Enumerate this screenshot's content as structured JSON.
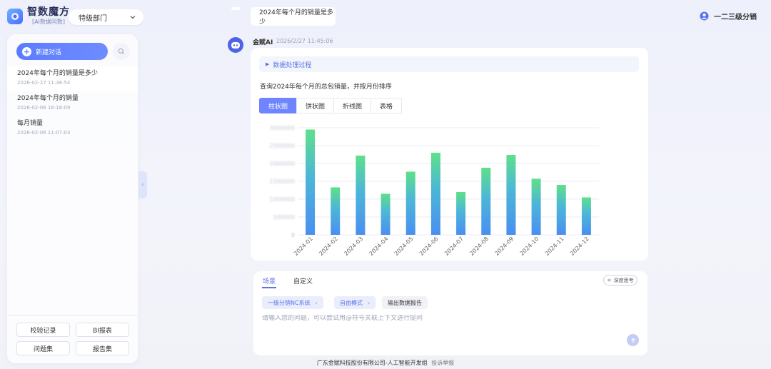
{
  "brand": {
    "name": "智数魔方",
    "subtitle": "[AI数据问数]"
  },
  "department_select": {
    "value": "特级部门"
  },
  "sidebar": {
    "new_chat_label": "新建对话",
    "conversations": [
      {
        "title": "2024年每个月的销量是多少",
        "time": "2026-02-27 11:38:54"
      },
      {
        "title": "2024年每个月的销量",
        "time": "2026-02-06 16:18:09"
      },
      {
        "title": "每月销量",
        "time": "2026-02-06 11:07:03"
      }
    ],
    "buttons": {
      "verify": "校验记录",
      "bi": "BI报表",
      "questions": "问题集",
      "reports": "报告集"
    }
  },
  "header": {
    "user_name": "一二三级分销"
  },
  "chat": {
    "user_message": "2024年每个月的销量是多少",
    "ai_name": "金赋AI",
    "ai_time": "2026/2/27 11:45:06",
    "process_label": "数据处理过程",
    "answer_text": "查询2024年每个月的总包销量，并按月份排序",
    "chart_tabs": [
      "柱状图",
      "饼状图",
      "折线图",
      "表格"
    ],
    "active_tab": 0
  },
  "chart_data": {
    "type": "bar",
    "categories": [
      "2024-01",
      "2024-02",
      "2024-03",
      "2024-04",
      "2024-05",
      "2024-06",
      "2024-07",
      "2024-08",
      "2024-09",
      "2024-10",
      "2024-11",
      "2024-12"
    ],
    "values": [
      2950000,
      1330000,
      2220000,
      1150000,
      1770000,
      2300000,
      1200000,
      1880000,
      2240000,
      1570000,
      1400000,
      1050000
    ],
    "ylim": [
      0,
      3000000
    ],
    "yticks": [
      0,
      500000,
      1000000,
      1500000,
      2000000,
      2500000,
      3000000
    ],
    "ytick_labels_blurred": true,
    "grid": true,
    "colors": {
      "bar_top": "#5ee08a",
      "bar_bottom": "#4a90f0"
    }
  },
  "input": {
    "tabs": [
      "场景",
      "自定义"
    ],
    "deep_think_label": "深度思考",
    "chips": [
      {
        "label": "一级分销NC系统",
        "style": "blue"
      },
      {
        "label": "自由模式",
        "style": "blue"
      },
      {
        "label": "输出数据报告",
        "style": "gray"
      }
    ],
    "placeholder": "请输入您的问题，可以尝试用@符号关联上下文进行提问"
  },
  "footer": {
    "company": "广东金赋科技股份有限公司-人工智能开发组",
    "report": "投诉举报"
  }
}
